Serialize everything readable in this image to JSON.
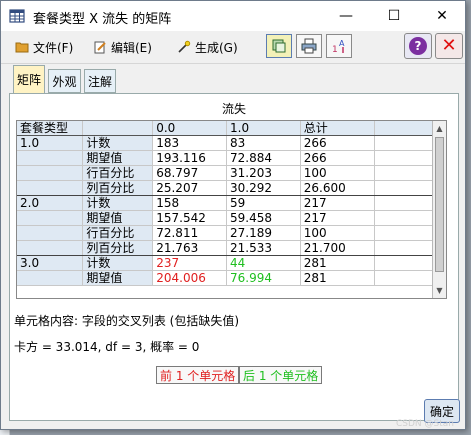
{
  "window": {
    "title": "套餐类型 X 流失 的矩阵",
    "controls": {
      "minimize": "—",
      "maximize": "☐",
      "close": "✕"
    }
  },
  "menubar": {
    "items": [
      {
        "label": "文件(F)",
        "icon": "file-folder-icon"
      },
      {
        "label": "编辑(E)",
        "icon": "edit-pencil-icon"
      },
      {
        "label": "生成(G)",
        "icon": "generate-wand-icon"
      }
    ],
    "toolbar": [
      "copy-data-icon",
      "print-icon",
      "sort-icon"
    ],
    "help_glyph": "?",
    "close_glyph": "✕"
  },
  "tabs": [
    {
      "label": "矩阵",
      "active": true
    },
    {
      "label": "外观",
      "active": false
    },
    {
      "label": "注解",
      "active": false
    }
  ],
  "matrix": {
    "column_field": "流失",
    "row_field": "套餐类型",
    "columns": [
      "0.0",
      "1.0",
      "总计"
    ],
    "rows": [
      {
        "group": "1.0",
        "stat": "计数",
        "values": [
          "183",
          "83",
          "266"
        ]
      },
      {
        "group": "",
        "stat": "期望值",
        "values": [
          "193.116",
          "72.884",
          "266"
        ]
      },
      {
        "group": "",
        "stat": "行百分比",
        "values": [
          "68.797",
          "31.203",
          "100"
        ]
      },
      {
        "group": "",
        "stat": "列百分比",
        "values": [
          "25.207",
          "30.292",
          "26.600"
        ]
      },
      {
        "group": "2.0",
        "stat": "计数",
        "values": [
          "158",
          "59",
          "217"
        ]
      },
      {
        "group": "",
        "stat": "期望值",
        "values": [
          "157.542",
          "59.458",
          "217"
        ]
      },
      {
        "group": "",
        "stat": "行百分比",
        "values": [
          "72.811",
          "27.189",
          "100"
        ]
      },
      {
        "group": "",
        "stat": "列百分比",
        "values": [
          "21.763",
          "21.533",
          "21.700"
        ]
      },
      {
        "group": "3.0",
        "stat": "计数",
        "values": [
          "237",
          "44",
          "281"
        ]
      },
      {
        "group": "",
        "stat": "期望值",
        "values": [
          "204.006",
          "76.994",
          "281"
        ]
      }
    ],
    "colors": {
      "red": "#e02020",
      "green": "#1fbf1f"
    }
  },
  "info": {
    "cell_contents": "单元格内容: 字段的交叉列表 (包括缺失值)",
    "chi_square": "卡方 = 33.014, df = 3, 概率 = 0"
  },
  "nav": {
    "prev": "前 1 个单元格",
    "next": "后 1 个单元格"
  },
  "ok_label": "确定",
  "watermark": "CSDN @Stan",
  "background_glyph": "文"
}
